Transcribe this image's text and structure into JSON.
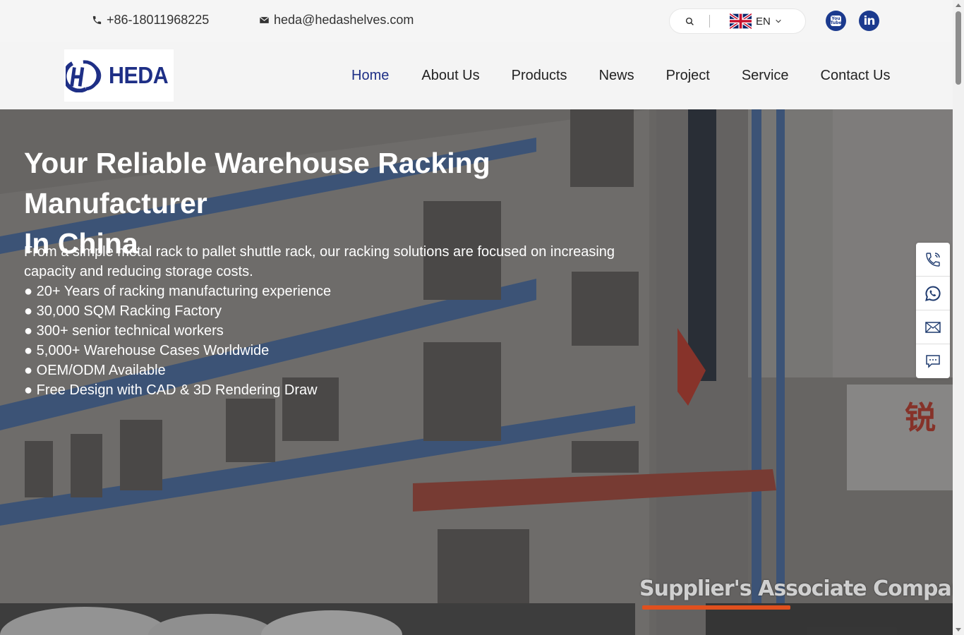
{
  "topbar": {
    "phone": "+86-18011968225",
    "email": "heda@hedashelves.com",
    "search_icon": "search-icon",
    "language": "EN",
    "flag_icon": "uk-flag-icon",
    "social": [
      "youtube-icon",
      "linkedin-icon"
    ]
  },
  "header": {
    "logo_text": "HEDA",
    "nav": [
      "Home",
      "About Us",
      "Products",
      "News",
      "Project",
      "Service",
      "Contact Us"
    ]
  },
  "hero": {
    "title_line1": "Your Reliable Warehouse Racking Manufacturer",
    "title_line2": "In China",
    "description": "From a simple metal rack to pallet shuttle rack, our racking solutions are focused on increasing capacity and reducing storage costs.",
    "bullets": [
      "20+ Years of racking manufacturing experience",
      "30,000 SQM Racking Factory",
      "300+ senior technical workers",
      "5,000+ Warehouse Cases Worldwide",
      "OEM/ODM Available",
      "Free Design with CAD & 3D Rendering Draw"
    ],
    "watermark": "Supplier's Associate Company"
  },
  "sidebar": {
    "buttons": [
      "phone-icon",
      "whatsapp-icon",
      "email-icon",
      "message-icon"
    ]
  },
  "colors": {
    "brand": "#1e2f86",
    "social_bg": "#1b3a8e",
    "accent_bar": "#e0501e"
  }
}
